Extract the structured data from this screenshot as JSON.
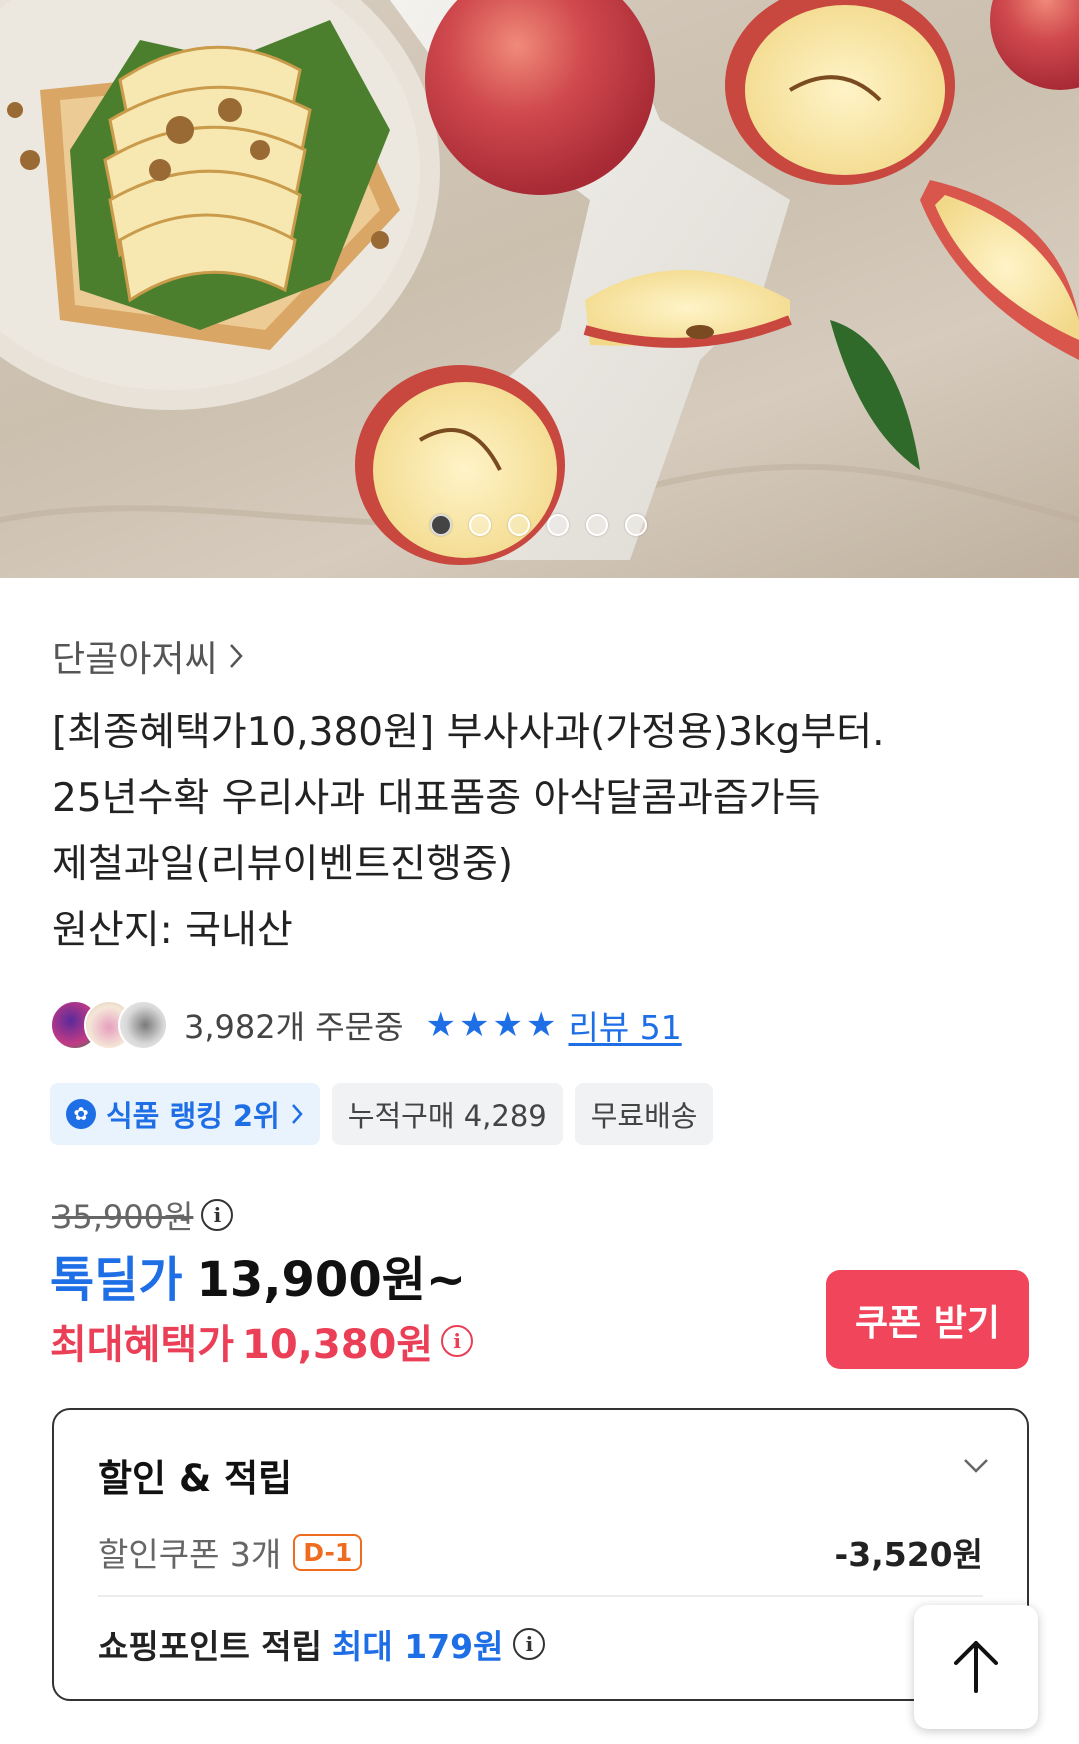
{
  "hero": {
    "image_name": "apple-product-photo",
    "slide_count": 6,
    "active_slide": 1
  },
  "seller": {
    "name": "단골아저씨",
    "chevron": "chevron-right-icon"
  },
  "title_lines": [
    "[최종혜택가10,380원] 부사사과(가정용)3kg부터.",
    "25년수확 우리사과 대표품종 아삭달콤과즙가득",
    "제철과일(리뷰이벤트진행중)",
    "원산지: 국내산"
  ],
  "social": {
    "orders_text": "3,982개 주문중",
    "star_rating": 4,
    "review_link": "리뷰 51"
  },
  "chips": {
    "ranking": "식품 랭킹 2위",
    "cumulative": "누적구매 4,289",
    "shipping": "무료배송"
  },
  "pricing": {
    "original_price": "35,900원",
    "deal_label": "톡딜가",
    "deal_price": "13,900원~",
    "best_label": "최대혜택가",
    "best_price": "10,380원",
    "coupon_button": "쿠폰 받기"
  },
  "benefits": {
    "title": "할인 & 적립",
    "coupon_label": "할인쿠폰 3개",
    "coupon_badge": "D-1",
    "coupon_amount": "-3,520원",
    "points_label": "쇼핑포인트 적립",
    "points_value": "최대 179원"
  },
  "colors": {
    "accent_blue": "#1e6ee6",
    "accent_red": "#ea3f56",
    "coupon_button": "#f0455b",
    "dday_orange": "#ef6b1f"
  }
}
